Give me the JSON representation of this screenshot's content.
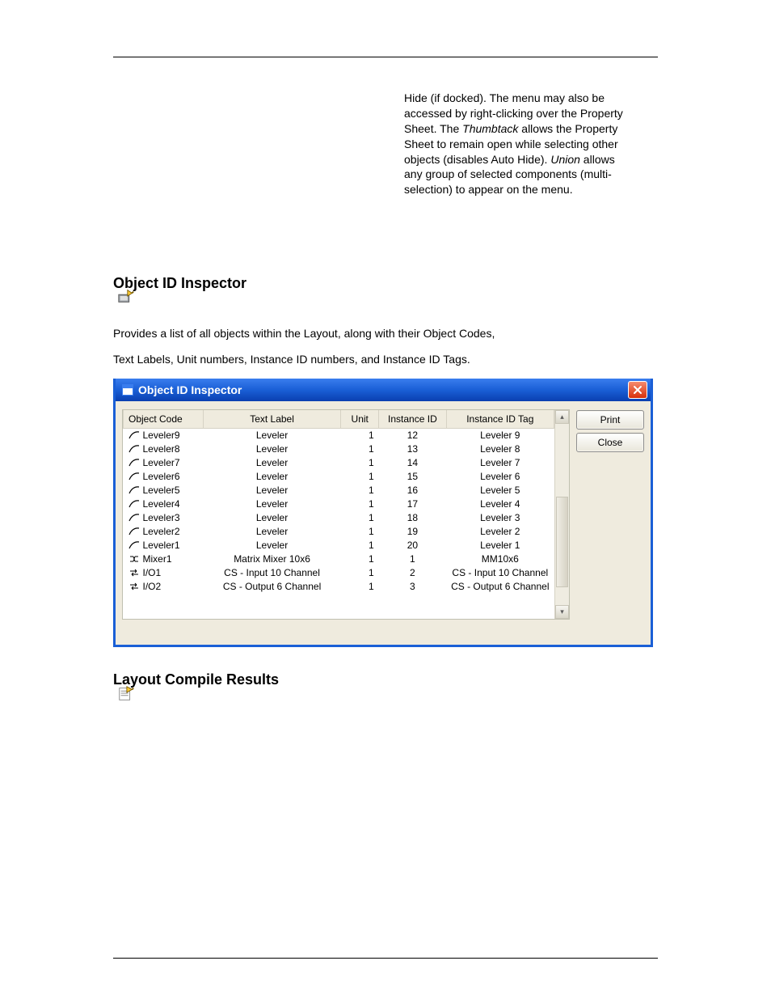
{
  "paragraph": {
    "line1a": "Hide (if docked). The menu may also be",
    "line2a": "accessed by right-clicking over the Property",
    "line3a": "Sheet. The ",
    "line3b_italic": "Thumbtack",
    "line3c": " allows the Property",
    "line4a": "Sheet to remain open while selecting other",
    "line5a": "objects (disables Auto Hide). ",
    "line5b_italic": "Union",
    "line5c": " allows",
    "line6a": "any group of selected components (multi-",
    "line7a": "selection) to appear on the menu."
  },
  "section1": {
    "title": "Object ID Inspector"
  },
  "desc1": "Provides a list of all objects within the Layout, along with their Object Codes,",
  "desc2": "Text Labels, Unit numbers, Instance ID numbers, and Instance ID Tags.",
  "window": {
    "title": "Object ID Inspector",
    "buttons": {
      "print": "Print",
      "close": "Close"
    },
    "headers": {
      "object_code": "Object Code",
      "text_label": "Text Label",
      "unit": "Unit",
      "instance_id": "Instance ID",
      "instance_id_tag": "Instance ID Tag"
    },
    "rows": [
      {
        "icon": "leveler",
        "code": "Leveler9",
        "label": "Leveler",
        "unit": "1",
        "iid": "12",
        "tag": "Leveler 9"
      },
      {
        "icon": "leveler",
        "code": "Leveler8",
        "label": "Leveler",
        "unit": "1",
        "iid": "13",
        "tag": "Leveler 8"
      },
      {
        "icon": "leveler",
        "code": "Leveler7",
        "label": "Leveler",
        "unit": "1",
        "iid": "14",
        "tag": "Leveler 7"
      },
      {
        "icon": "leveler",
        "code": "Leveler6",
        "label": "Leveler",
        "unit": "1",
        "iid": "15",
        "tag": "Leveler 6"
      },
      {
        "icon": "leveler",
        "code": "Leveler5",
        "label": "Leveler",
        "unit": "1",
        "iid": "16",
        "tag": "Leveler 5"
      },
      {
        "icon": "leveler",
        "code": "Leveler4",
        "label": "Leveler",
        "unit": "1",
        "iid": "17",
        "tag": "Leveler 4"
      },
      {
        "icon": "leveler",
        "code": "Leveler3",
        "label": "Leveler",
        "unit": "1",
        "iid": "18",
        "tag": "Leveler 3"
      },
      {
        "icon": "leveler",
        "code": "Leveler2",
        "label": "Leveler",
        "unit": "1",
        "iid": "19",
        "tag": "Leveler 2"
      },
      {
        "icon": "leveler",
        "code": "Leveler1",
        "label": "Leveler",
        "unit": "1",
        "iid": "20",
        "tag": "Leveler 1"
      },
      {
        "icon": "mixer",
        "code": "Mixer1",
        "label": "Matrix Mixer 10x6",
        "unit": "1",
        "iid": "1",
        "tag": "MM10x6"
      },
      {
        "icon": "io",
        "code": "I/O1",
        "label": "CS - Input 10 Channel",
        "unit": "1",
        "iid": "2",
        "tag": "CS - Input 10 Channel"
      },
      {
        "icon": "io",
        "code": "I/O2",
        "label": "CS - Output 6 Channel",
        "unit": "1",
        "iid": "3",
        "tag": "CS - Output 6 Channel"
      }
    ]
  },
  "section2": {
    "title": "Layout Compile Results"
  }
}
